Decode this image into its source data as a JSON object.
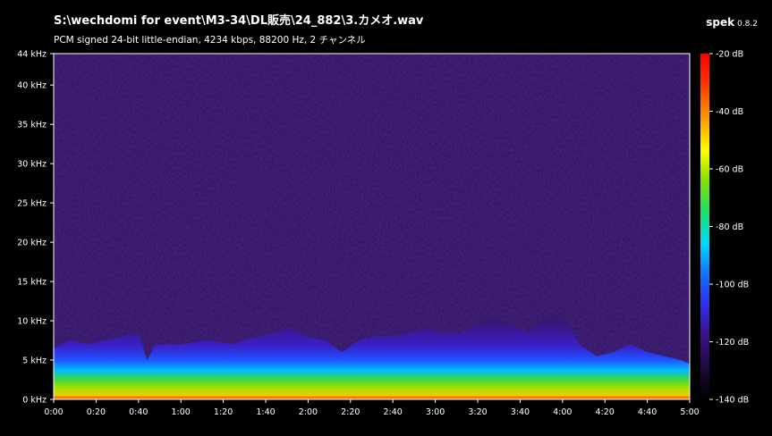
{
  "file_title": "S:\\wechdomi for event\\M3-34\\DL販売\\24_882\\3.カメオ.wav",
  "stream_info": "PCM signed 24-bit little-endian, 4234 kbps, 88200 Hz, 2 チャンネル",
  "brand": {
    "name": "spek",
    "version": "0.8.2"
  },
  "colors": {
    "background": "#000000",
    "plot_floor": "#2a0f5e",
    "axis": "#ffffff"
  },
  "chart_data": {
    "type": "heatmap",
    "title": "",
    "x_ticks": [
      "0:00",
      "0:20",
      "0:40",
      "1:00",
      "1:20",
      "1:40",
      "2:00",
      "2:20",
      "2:40",
      "3:00",
      "3:20",
      "3:40",
      "4:00",
      "4:20",
      "4:40",
      "5:00"
    ],
    "y_ticks": [
      "0 kHz",
      "5 kHz",
      "10 kHz",
      "15 kHz",
      "20 kHz",
      "25 kHz",
      "30 kHz",
      "35 kHz",
      "40 kHz",
      "44 kHz"
    ],
    "xlim_seconds": [
      0,
      300
    ],
    "ylim_khz": [
      0,
      44
    ],
    "colorbar_ticks": [
      "-20 dB",
      "-40 dB",
      "-60 dB",
      "-80 dB",
      "-100 dB",
      "-120 dB",
      "-140 dB"
    ],
    "colorbar_range_db": [
      -140,
      -20
    ],
    "energy_envelope": {
      "time_s": [
        0,
        8,
        16,
        24,
        32,
        40,
        44,
        48,
        60,
        72,
        84,
        96,
        104,
        112,
        120,
        128,
        136,
        144,
        152,
        160,
        168,
        176,
        184,
        192,
        200,
        208,
        216,
        224,
        232,
        240,
        248,
        256,
        264,
        272,
        280,
        288,
        296,
        300
      ],
      "top_khz": [
        6.5,
        7.5,
        7.0,
        7.5,
        8.0,
        8.5,
        5.0,
        7.0,
        7.0,
        7.5,
        7.0,
        8.0,
        8.5,
        9.0,
        8.0,
        7.5,
        6.0,
        7.5,
        8.0,
        8.0,
        8.5,
        9.0,
        8.5,
        8.5,
        9.5,
        10.5,
        9.5,
        8.5,
        10.5,
        11.0,
        7.0,
        5.5,
        6.0,
        7.0,
        6.0,
        5.5,
        5.0,
        4.5
      ]
    }
  }
}
